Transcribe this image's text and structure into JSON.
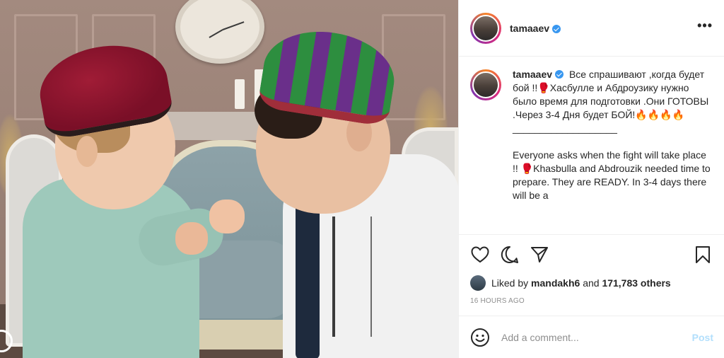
{
  "post": {
    "username": "tamaaev",
    "more_label": "•••",
    "caption_ru": "Все спрашивают ,когда будет бой !!🥊Хасбулле и Абдроузику нужно было время для подготовки .Они ГОТОВЫ .Через 3-4 Дня будет БОЙ!🔥🔥🔥🔥\n___________________\n\nEveryone asks when the fight will take place !! 🥊Khasbulla and Abdrouzik needed time to prepare. They are READY. In 3-4 days there will be a",
    "liked_prefix": "Liked by",
    "liked_user": "mandakh6",
    "liked_and": "and",
    "liked_others": "171,783 others",
    "timestamp": "16 HOURS AGO"
  },
  "comment": {
    "placeholder": "Add a comment...",
    "post_label": "Post"
  },
  "icons": {
    "like": "heart-icon",
    "comment": "comment-icon",
    "share": "send-icon",
    "save": "bookmark-icon",
    "emoji": "smiley-icon",
    "verified": "verified-badge-icon"
  },
  "colors": {
    "verified": "#3897f0",
    "post_button_disabled": "#b2dffc",
    "muted_text": "#8e8e8e"
  }
}
